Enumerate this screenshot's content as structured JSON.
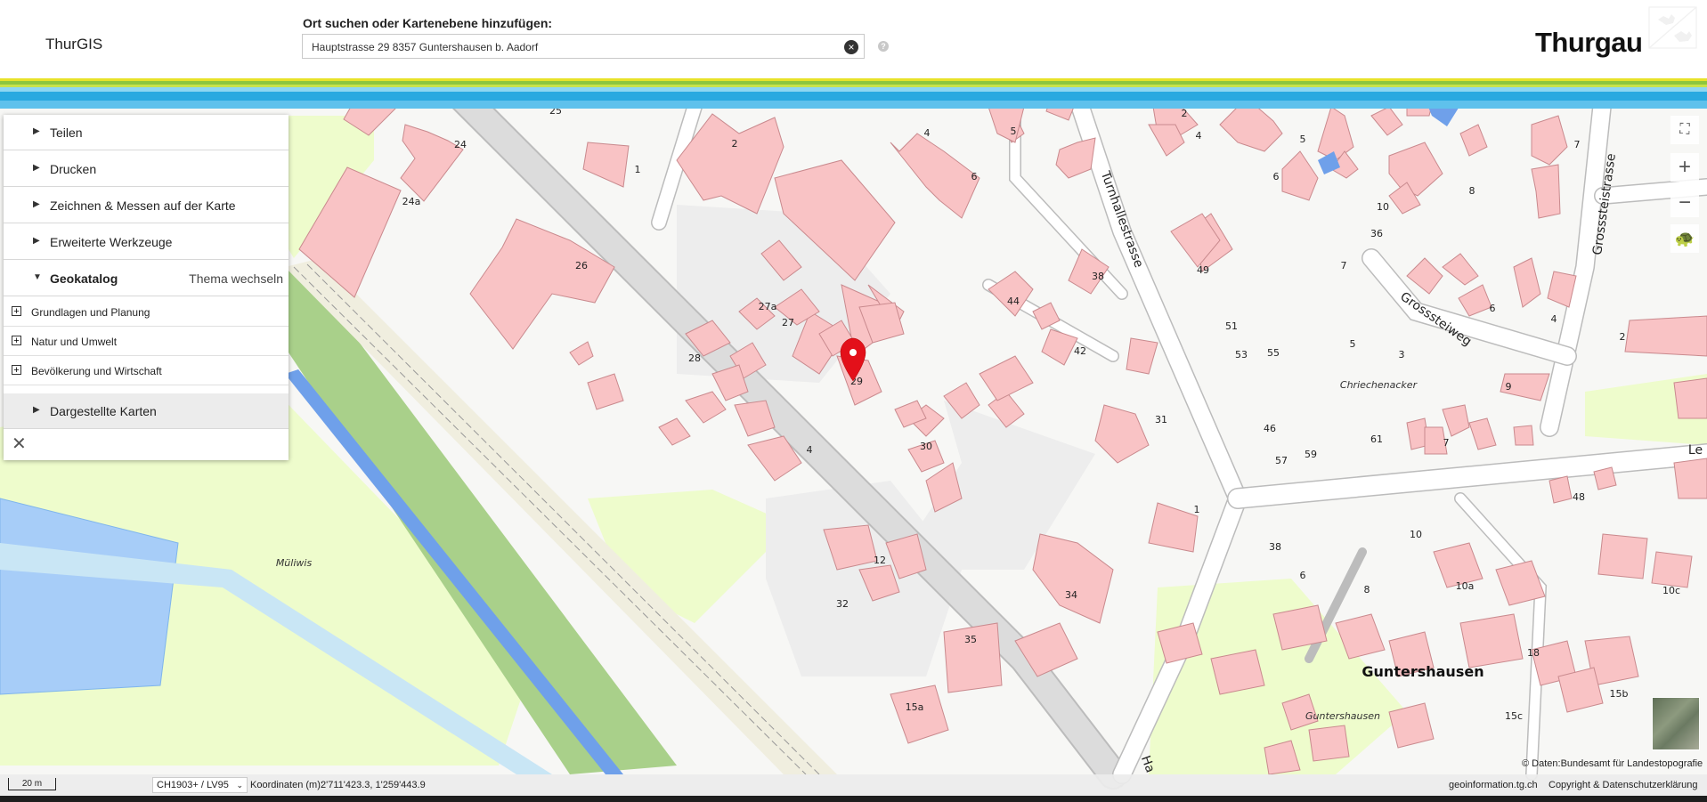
{
  "header": {
    "app_title": "ThurGIS",
    "search_label": "Ort suchen oder Kartenebene hinzufügen:",
    "search_value": "Hauptstrasse 29 8357 Guntershausen b. Aadorf",
    "brand": "Thurgau",
    "clear_icon": "close-circle-icon",
    "help_icon": "question-icon"
  },
  "panel": {
    "items": [
      {
        "label": "Teilen"
      },
      {
        "label": "Drucken"
      },
      {
        "label": "Zeichnen & Messen auf der Karte"
      },
      {
        "label": "Erweiterte Werkzeuge"
      }
    ],
    "geokatalog": {
      "label": "Geokatalog",
      "theme_link": "Thema wechseln"
    },
    "categories": [
      {
        "label": "Grundlagen und Planung"
      },
      {
        "label": "Natur und Umwelt"
      },
      {
        "label": "Bevölkerung und Wirtschaft"
      }
    ],
    "maps": {
      "label": "Dargestellte Karten"
    }
  },
  "map": {
    "place_labels": {
      "guntershausen": "Guntershausen",
      "guntershausen_small": "Guntershausen",
      "muliwis": "Müliwis",
      "chriechenacker": "Chriechenacker"
    },
    "streets": {
      "turnhallestrasse": "Turnhallestrasse",
      "grosssteiweg": "Grosssteiweg",
      "grosssteistrasse": "Grosssteistrasse",
      "hauptstrasse_partial": "Ha",
      "le_partial": "Le"
    },
    "house_numbers": [
      "25",
      "24",
      "24a",
      "1",
      "2",
      "4",
      "6",
      "5",
      "2",
      "4",
      "5",
      "7",
      "6",
      "10",
      "8",
      "26",
      "27a",
      "27",
      "38",
      "49",
      "44",
      "42",
      "28",
      "29",
      "51",
      "53",
      "55",
      "5",
      "3",
      "7",
      "6",
      "4",
      "2",
      "4",
      "30",
      "31",
      "46",
      "57",
      "59",
      "61",
      "7",
      "9",
      "1",
      "48",
      "12",
      "32",
      "34",
      "35",
      "38",
      "6",
      "8",
      "10",
      "10a",
      "10c",
      "18",
      "15b",
      "15c",
      "15a",
      "36",
      "5"
    ],
    "marker_icon": "location-pin-icon"
  },
  "controls": {
    "fullscreen_icon": "fullscreen-icon",
    "zoom_in_icon": "plus-icon",
    "zoom_out_icon": "minus-icon",
    "turtle_icon": "turtle-icon"
  },
  "footer": {
    "scale": "20 m",
    "crs": "CH1903+ / LV95",
    "coords_label": "Koordinaten (m):",
    "coords_value": "2'711'423.3, 1'259'443.9",
    "link_geo": "geoinformation.tg.ch",
    "link_copyright": "Copyright & Datenschutzerklärung",
    "attribution": "© Daten:Bundesamt für Landestopografie"
  },
  "colors": {
    "building": "#f9c3c5",
    "building_stroke": "#c98a8e",
    "road": "#ffffff",
    "road_casing": "#bcbcbc",
    "greenland": "#eefccc",
    "river": "#6fa0ea",
    "lake": "#a7cdf8",
    "stripe_yellow": "#e8e229",
    "stripe_green": "#8dc63f",
    "stripe_blue": "#2aa9e0",
    "marker": "#e3101a"
  }
}
